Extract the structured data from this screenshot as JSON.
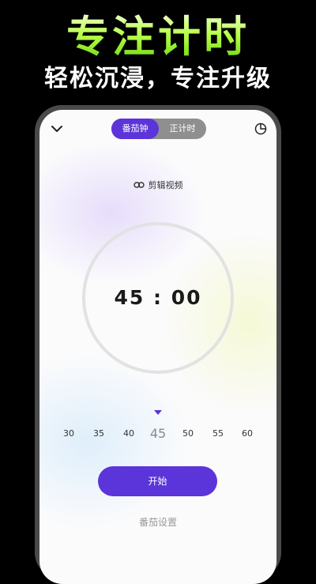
{
  "promo": {
    "headline": "专注计时",
    "subheadline": "轻松沉浸，专注升级"
  },
  "topbar": {
    "back_icon": "chevron-down-icon",
    "modes": [
      {
        "label": "番茄钟",
        "active": true
      },
      {
        "label": "正计时",
        "active": false
      }
    ],
    "stats_icon": "pie-chart-icon"
  },
  "clip_link": {
    "icon": "link-icon",
    "label": "剪辑视频"
  },
  "timer": {
    "display": "45 : 00"
  },
  "duration_picker": {
    "options": [
      "30",
      "35",
      "40",
      "45",
      "50",
      "55",
      "60"
    ],
    "selected": "45"
  },
  "start_button": {
    "label": "开始"
  },
  "settings_link": {
    "label": "番茄设置"
  },
  "colors": {
    "accent": "#5B35D9",
    "headline_green": "#9BEF2F",
    "ring": "#E2E2E2"
  }
}
